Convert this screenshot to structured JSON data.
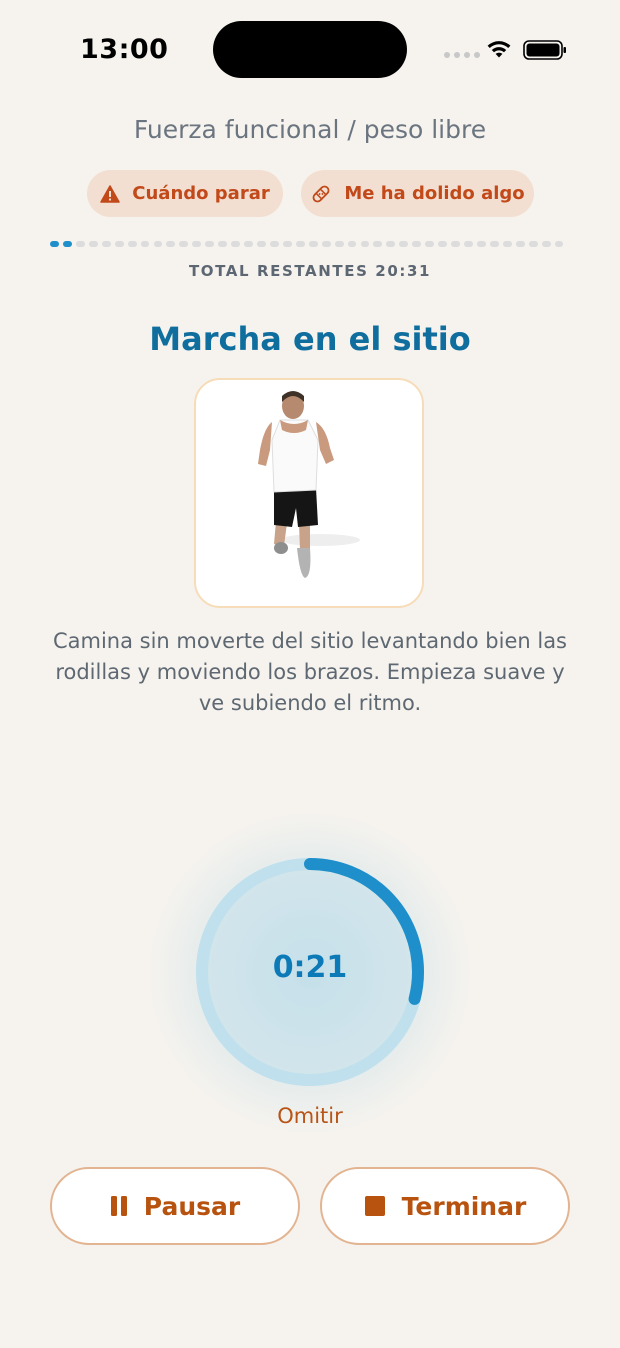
{
  "status_bar": {
    "time": "13:00"
  },
  "header": {
    "session_title": "Fuerza funcional / peso libre"
  },
  "actions": {
    "when_to_stop": "Cuándo parar",
    "hurt_something": "Me ha dolido algo"
  },
  "progress": {
    "total_steps": 40,
    "completed_steps": 2
  },
  "remaining_label": "TOTAL RESTANTES 20:31",
  "exercise": {
    "title": "Marcha en el sitio",
    "description": "Camina sin moverte del sitio levantando bien las rodillas y moviendo los brazos. Empieza suave y ve subiendo el ritmo."
  },
  "timer": {
    "display": "0:21",
    "progress_fraction": 0.29
  },
  "controls": {
    "skip_label": "Omitir",
    "pause_label": "Pausar",
    "stop_label": "Terminar"
  },
  "colors": {
    "accent": "#1e8fca",
    "title": "#0f6e9e",
    "warning_text": "#c1491a",
    "button_text": "#b8520f",
    "background": "#f6f3ee"
  },
  "icons": {
    "warning": "warning-triangle-icon",
    "bandage": "bandage-icon",
    "pause": "pause-icon",
    "stop": "stop-icon"
  }
}
